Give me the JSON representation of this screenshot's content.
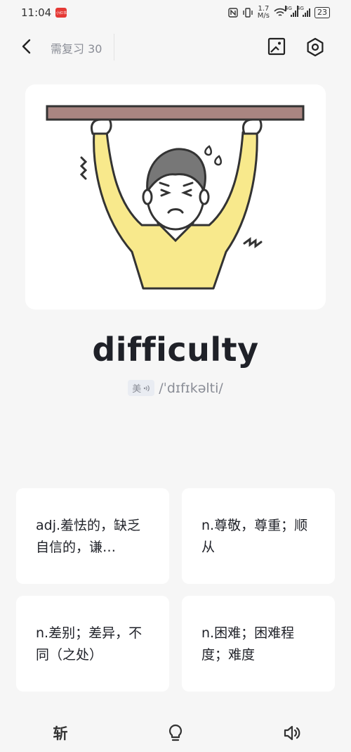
{
  "status_bar": {
    "time": "11:04",
    "app_badge": "小红书",
    "speed_value": "1.7",
    "speed_unit": "M/s",
    "sig1": "4G",
    "sig2": "4G",
    "battery": "23"
  },
  "header": {
    "review_label": "需复习 30"
  },
  "word": {
    "text": "difficulty",
    "accent": "美",
    "phonetic": "/ˈdɪfɪkəlti/"
  },
  "options": [
    {
      "text": "adj.羞怯的，缺乏自信的，谦…"
    },
    {
      "text": "n.尊敬，尊重；顺从"
    },
    {
      "text": "n.差别；差异，不同（之处）"
    },
    {
      "text": "n.困难；困难程度；难度"
    }
  ],
  "toolbar": {
    "slash_label": "斩"
  },
  "colors": {
    "background": "#f6f6f6",
    "card": "#ffffff",
    "muted_text": "#8a8d96",
    "shirt": "#f8e98c",
    "board": "#a98581"
  },
  "icons": {
    "back": "chevron-left-icon",
    "image_toggle": "image-icon",
    "settings": "hexagon-gear-icon",
    "hint": "lightbulb-icon",
    "sound": "speaker-icon"
  }
}
